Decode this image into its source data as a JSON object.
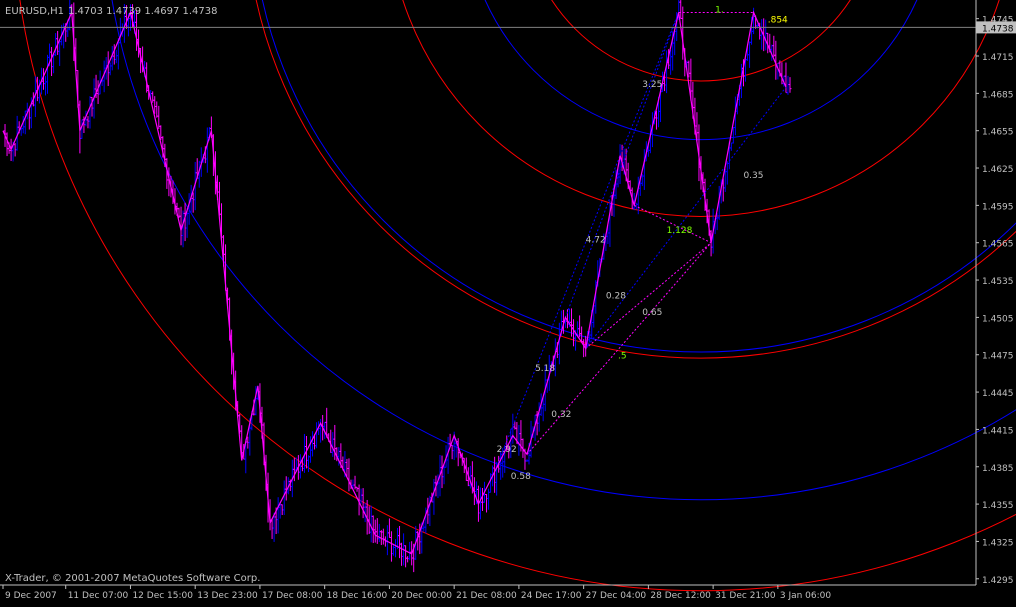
{
  "header": {
    "symbol": "EURUSD,H1",
    "ohlc": "1.4703 1.4739 1.4697 1.4738"
  },
  "footer": {
    "copyright": "X-Trader, © 2001-2007 MetaQuotes Software Corp."
  },
  "colors": {
    "background": "#000000",
    "axis": "#c0c0c0",
    "text": "#c0c0c0",
    "bar_up": "#0000ff",
    "bar_down": "#ff00ff",
    "zigzag": "#ff00ff",
    "arc_red": "#ff0000",
    "arc_blue": "#0000ff",
    "fib_line": "#ff00ff",
    "fib_dotted": "#0000ff",
    "label_yellow": "#ffff00",
    "label_green": "#7cff00",
    "price_line": "#808080",
    "price_tag_bg": "#c0c0c0",
    "price_tag_text": "#000000"
  },
  "chart_data": {
    "type": "line",
    "ylim": [
      1.429,
      1.476
    ],
    "y_ticks": [
      1.4745,
      1.4715,
      1.4685,
      1.4655,
      1.4625,
      1.4595,
      1.4565,
      1.4535,
      1.4505,
      1.4475,
      1.4445,
      1.4415,
      1.4385,
      1.4355,
      1.4325,
      1.4295
    ],
    "y_tick_labels": [
      "1.4745",
      "1.4715",
      "1.4685",
      "1.4655",
      "1.4625",
      "1.4595",
      "1.4565",
      "1.4535",
      "1.4505",
      "1.4475",
      "1.4445",
      "1.4415",
      "1.4385",
      "1.4355",
      "1.4325",
      "1.4295"
    ],
    "current_price": 1.4738,
    "current_price_label": "1.4738",
    "x_labels": [
      "9 Dec 2007",
      "11 Dec 07:00",
      "12 Dec 15:00",
      "13 Dec 23:00",
      "17 Dec 08:00",
      "18 Dec 16:00",
      "20 Dec 00:00",
      "21 Dec 08:00",
      "24 Dec 17:00",
      "27 Dec 04:00",
      "28 Dec 12:00",
      "31 Dec 21:00",
      "3 Jan 06:00"
    ],
    "x_label_bar_index": [
      0,
      31,
      63,
      95,
      127,
      159,
      191,
      223,
      255,
      287,
      319,
      351,
      383
    ],
    "bar_count": 390,
    "zigzag": [
      {
        "bar": 0,
        "price": 1.4655
      },
      {
        "bar": 4,
        "price": 1.464
      },
      {
        "bar": 34,
        "price": 1.475
      },
      {
        "bar": 38,
        "price": 1.4655
      },
      {
        "bar": 63,
        "price": 1.475
      },
      {
        "bar": 88,
        "price": 1.4575
      },
      {
        "bar": 103,
        "price": 1.4655
      },
      {
        "bar": 118,
        "price": 1.439
      },
      {
        "bar": 126,
        "price": 1.445
      },
      {
        "bar": 132,
        "price": 1.434
      },
      {
        "bar": 157,
        "price": 1.442
      },
      {
        "bar": 184,
        "price": 1.433
      },
      {
        "bar": 202,
        "price": 1.4315
      },
      {
        "bar": 223,
        "price": 1.441
      },
      {
        "bar": 235,
        "price": 1.4355
      },
      {
        "bar": 252,
        "price": 1.441
      },
      {
        "bar": 259,
        "price": 1.4395
      },
      {
        "bar": 278,
        "price": 1.4505
      },
      {
        "bar": 288,
        "price": 1.448
      },
      {
        "bar": 305,
        "price": 1.4635
      },
      {
        "bar": 312,
        "price": 1.4595
      },
      {
        "bar": 334,
        "price": 1.475
      },
      {
        "bar": 350,
        "price": 1.4565
      },
      {
        "bar": 371,
        "price": 1.475
      },
      {
        "bar": 387,
        "price": 1.469
      }
    ],
    "fib_labels": [
      {
        "text": "1.",
        "bar": 352,
        "price": 1.475,
        "color": "#7cff00"
      },
      {
        "text": ".854",
        "bar": 378,
        "price": 1.4742,
        "color": "#ffff00"
      },
      {
        "text": "3.25",
        "bar": 316,
        "price": 1.469,
        "color": "#c0c0c0"
      },
      {
        "text": "4.72",
        "bar": 288,
        "price": 1.4565,
        "color": "#c0c0c0"
      },
      {
        "text": "1.128",
        "bar": 328,
        "price": 1.4573,
        "color": "#7cff00"
      },
      {
        "text": "0.35",
        "bar": 366,
        "price": 1.4617,
        "color": "#c0c0c0"
      },
      {
        "text": "0.28",
        "bar": 298,
        "price": 1.452,
        "color": "#c0c0c0"
      },
      {
        "text": "0.65",
        "bar": 316,
        "price": 1.4507,
        "color": "#c0c0c0"
      },
      {
        "text": ".5",
        "bar": 304,
        "price": 1.4472,
        "color": "#7cff00"
      },
      {
        "text": "5.18",
        "bar": 263,
        "price": 1.4462,
        "color": "#c0c0c0"
      },
      {
        "text": "0.32",
        "bar": 271,
        "price": 1.4425,
        "color": "#c0c0c0"
      },
      {
        "text": "2.92",
        "bar": 244,
        "price": 1.4397,
        "color": "#c0c0c0"
      },
      {
        "text": "0.58",
        "bar": 251,
        "price": 1.4375,
        "color": "#c0c0c0"
      }
    ],
    "fib_solid_lines": [
      [
        {
          "bar": 288,
          "price": 1.448
        },
        {
          "bar": 350,
          "price": 1.4565
        }
      ],
      [
        {
          "bar": 312,
          "price": 1.4595
        },
        {
          "bar": 350,
          "price": 1.4565
        }
      ],
      [
        {
          "bar": 334,
          "price": 1.475
        },
        {
          "bar": 371,
          "price": 1.475
        }
      ],
      [
        {
          "bar": 259,
          "price": 1.4395
        },
        {
          "bar": 350,
          "price": 1.4565
        }
      ]
    ],
    "fib_dotted_lines": [
      [
        {
          "bar": 244,
          "price": 1.4385
        },
        {
          "bar": 305,
          "price": 1.4635
        }
      ],
      [
        {
          "bar": 278,
          "price": 1.4505
        },
        {
          "bar": 334,
          "price": 1.475
        }
      ],
      [
        {
          "bar": 288,
          "price": 1.448
        },
        {
          "bar": 387,
          "price": 1.469
        }
      ],
      [
        {
          "bar": 305,
          "price": 1.4635
        },
        {
          "bar": 334,
          "price": 1.475
        }
      ]
    ],
    "arcs_red": [
      {
        "center_bar": 345,
        "center_price": 1.4838,
        "radius_bars": 340
      },
      {
        "center_bar": 345,
        "center_price": 1.4838,
        "radius_bars": 225
      },
      {
        "center_bar": 345,
        "center_price": 1.4838,
        "radius_bars": 155
      },
      {
        "center_bar": 345,
        "center_price": 1.4838,
        "radius_bars": 88
      }
    ],
    "arcs_blue": [
      {
        "center_bar": 345,
        "center_price": 1.4838,
        "radius_bars": 117
      },
      {
        "center_bar": 345,
        "center_price": 1.4838,
        "radius_bars": 222
      },
      {
        "center_bar": 345,
        "center_price": 1.4838,
        "radius_bars": 295
      }
    ],
    "grid": false
  }
}
